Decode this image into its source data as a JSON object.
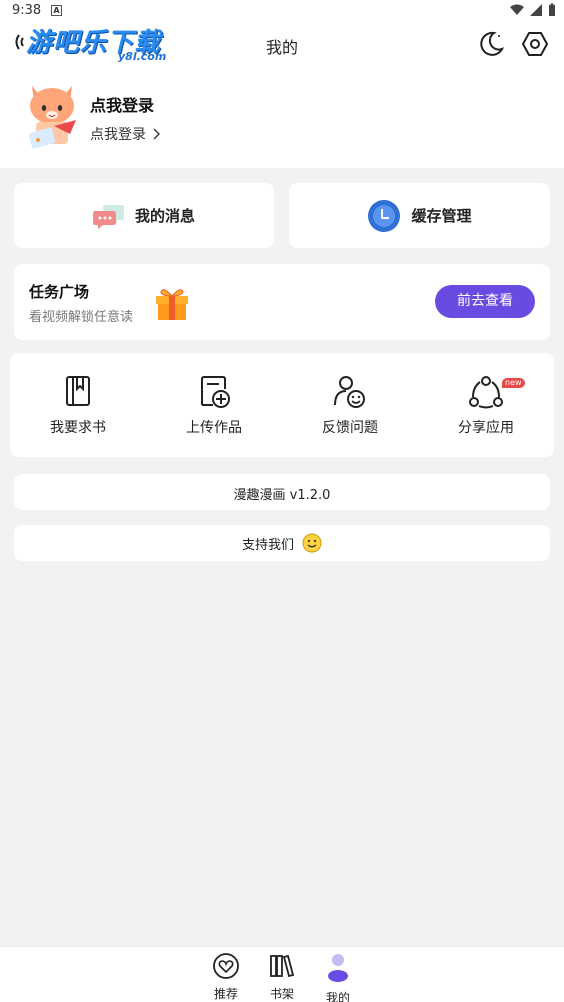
{
  "status_bar": {
    "time": "9:38",
    "badge": "A"
  },
  "watermark": {
    "text": "游吧乐下载",
    "sub": "y8l.com"
  },
  "header": {
    "title": "我的"
  },
  "profile": {
    "name": "点我登录",
    "login_link": "点我登录"
  },
  "quick_cards": {
    "messages": {
      "label": "我的消息"
    },
    "cache": {
      "label": "缓存管理"
    }
  },
  "task": {
    "title": "任务广场",
    "subtitle": "看视频解锁任意读",
    "button": "前去查看"
  },
  "tools": [
    {
      "label": "我要求书",
      "icon": "book-icon"
    },
    {
      "label": "上传作品",
      "icon": "upload-doc-icon"
    },
    {
      "label": "反馈问题",
      "icon": "feedback-icon"
    },
    {
      "label": "分享应用",
      "icon": "share-icon",
      "badge": "new"
    }
  ],
  "version": {
    "text": "漫趣漫画 v1.2.0"
  },
  "support": {
    "text": "支持我们"
  },
  "bottom_nav": [
    {
      "label": "推荐",
      "icon": "heart-icon"
    },
    {
      "label": "书架",
      "icon": "bookshelf-icon"
    },
    {
      "label": "我的",
      "icon": "user-icon",
      "active": true
    }
  ],
  "colors": {
    "accent": "#6a4be2",
    "background": "#f2f2f2",
    "card": "#ffffff"
  }
}
